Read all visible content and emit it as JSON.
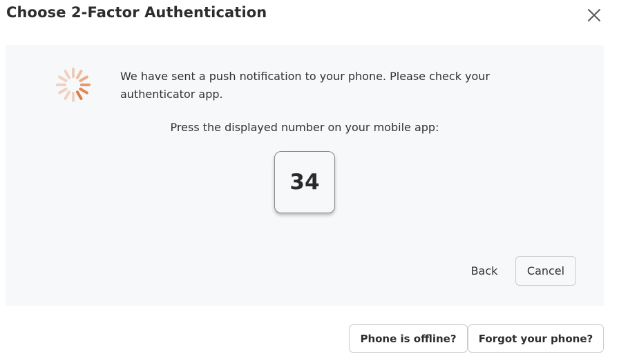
{
  "dialog": {
    "title": "Choose 2-Factor Authentication",
    "close_icon": "close-icon"
  },
  "panel": {
    "spinner_icon": "loading-spinner-icon",
    "spinner_color": "#e07a43",
    "message": "We have sent a push notification to your phone. Please check your authenticator app.",
    "instruction": "Press the displayed number on your mobile app:",
    "number": "34",
    "back_label": "Back",
    "cancel_label": "Cancel"
  },
  "footer": {
    "offline_label": "Phone is offline?",
    "forgot_label": "Forgot your phone?"
  }
}
